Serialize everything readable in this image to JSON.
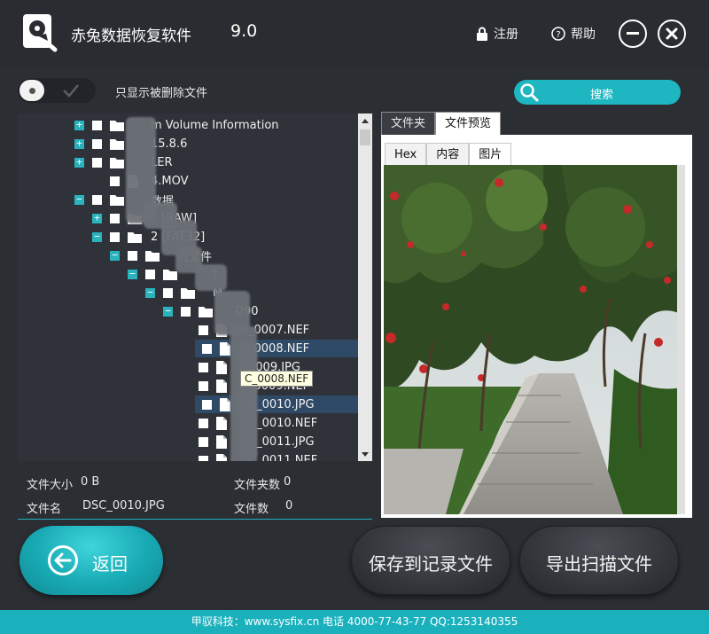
{
  "titlebar": {
    "app_name": "赤兔数据恢复软件",
    "version": "9.0",
    "register_label": "注册",
    "help_label": "帮助",
    "logo_icon": "drive-hammer-icon",
    "minimize_icon": "minus-icon",
    "close_icon": "close-icon"
  },
  "filter": {
    "toggle_label": "只显示被删除文件",
    "toggle_on": false
  },
  "search": {
    "label": "搜索",
    "icon": "search-icon"
  },
  "tree": {
    "rows": [
      {
        "label": "m Volume Information",
        "expander": "+"
      },
      {
        "label": "15.8.6",
        "expander": "+"
      },
      {
        "label": "LER",
        "expander": "+"
      },
      {
        "label": "4.MOV",
        "expander": ""
      },
      {
        "label": "数据",
        "expander": "−"
      },
      {
        "label": "1 [RAW]",
        "expander": "+"
      },
      {
        "label": "2 [FAT32]",
        "expander": "−"
      },
      {
        "label": "的文件",
        "expander": "−"
      },
      {
        "label": "t",
        "expander": "−"
      },
      {
        "label": "M",
        "expander": "−"
      },
      {
        "label": "D90",
        "expander": "−"
      },
      {
        "label": "_0007.NEF",
        "expander": ""
      },
      {
        "label": "_0008.NEF",
        "expander": ""
      },
      {
        "label": "0009.JPG",
        "expander": ""
      },
      {
        "label": "_0009.NEF",
        "expander": ""
      },
      {
        "label": "C_0010.JPG",
        "expander": ""
      },
      {
        "label": "C_0010.NEF",
        "expander": ""
      },
      {
        "label": "C_0011.JPG",
        "expander": ""
      },
      {
        "label": "C_0011.NEF",
        "expander": ""
      }
    ],
    "tooltip": "C_0008.NEF"
  },
  "info": {
    "size_label": "文件大小",
    "size_value": "0 B",
    "folder_count_label": "文件夹数",
    "folder_count_value": "0",
    "name_label": "文件名",
    "name_value": "DSC_0010.JPG",
    "file_count_label": "文件数",
    "file_count_value": "0"
  },
  "preview": {
    "tabs": [
      "文件夹",
      "文件预览"
    ],
    "active_tab": 1,
    "subtabs": [
      "Hex",
      "内容",
      "图片"
    ],
    "active_subtab": 2
  },
  "buttons": {
    "back": "返回",
    "save_record": "保存到记录文件",
    "export_scan": "导出扫描文件"
  },
  "footer": {
    "text": "甲驭科技：www.sysfix.cn 电话 4000-77-43-77 QQ:1253140355"
  },
  "colors": {
    "accent": "#1ab1bd",
    "background": "#2b2e33",
    "highlight": "#2f4a66"
  }
}
